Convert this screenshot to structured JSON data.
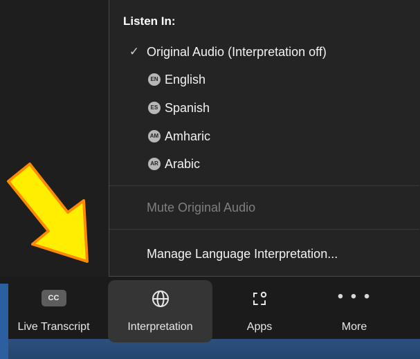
{
  "menu": {
    "title": "Listen In:",
    "options": [
      {
        "check": "✓",
        "label": "Original Audio (Interpretation off)"
      },
      {
        "badge": "EN",
        "label": "English"
      },
      {
        "badge": "ES",
        "label": "Spanish"
      },
      {
        "badge": "AM",
        "label": "Amharic"
      },
      {
        "badge": "AR",
        "label": "Arabic"
      }
    ],
    "mute_label": "Mute Original Audio",
    "manage_label": "Manage Language Interpretation..."
  },
  "toolbar": {
    "live_transcript": {
      "icon": "cc-icon",
      "icon_text": "CC",
      "label": "Live Transcript"
    },
    "interpretation": {
      "icon": "globe-icon",
      "label": "Interpretation"
    },
    "apps": {
      "icon": "apps-icon",
      "label": "Apps"
    },
    "more": {
      "icon": "more-icon",
      "icon_text": "• • •",
      "label": "More"
    }
  },
  "colors": {
    "menu_bg": "#242424",
    "toolbar_bg": "#1b1b1b",
    "active_bg": "#353535",
    "arrow_fill": "#ffee00",
    "arrow_stroke": "#ff8a00"
  }
}
